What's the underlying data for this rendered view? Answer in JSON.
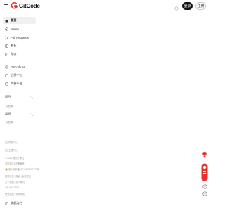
{
  "header": {
    "logo_text": "GitCode",
    "login_label": "登录",
    "register_label": "注册"
  },
  "colors": {
    "brand": "#e5322d",
    "active_bg": "#f0f0f3",
    "dark_button": "#111111",
    "muted_text": "#999999"
  },
  "sidebar": {
    "items": [
      {
        "label": "首页",
        "icon": "home-icon"
      },
      {
        "label": "Issues",
        "icon": "issues-icon"
      },
      {
        "label": "Pull Requests",
        "icon": "pull-request-icon"
      },
      {
        "label": "看板",
        "icon": "board-icon"
      },
      {
        "label": "动态",
        "icon": "activity-icon"
      },
      {
        "label": "GitCode AI",
        "icon": "ai-icon"
      },
      {
        "label": "启思中心",
        "icon": "learning-icon"
      },
      {
        "label": "大赛平台",
        "icon": "contest-icon"
      }
    ],
    "projects": {
      "title": "项目",
      "link": "去登录"
    },
    "orgs": {
      "title": "组织",
      "link": "去登录"
    },
    "footer": [
      "帮助中心",
      "主题中心",
      "© 2025 重庆开源社",
      "重庆市区ICP备案号",
      "渝公网安备50010502000173号",
      "服务协议 | 隐私 | 反馈建议",
      "关于我们 | 加入我们",
      "400-660-0108",
      "营业执照 | 公司资质"
    ],
    "collapse_label": "收起边栏"
  }
}
